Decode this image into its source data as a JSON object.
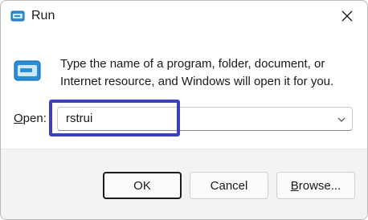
{
  "window": {
    "title": "Run"
  },
  "dialog": {
    "description": "Type the name of a program, folder, document, or Internet resource, and Windows will open it for you.",
    "open_label_accel": "O",
    "open_label_rest": "pen:",
    "open_value": "rstrui"
  },
  "buttons": {
    "ok": "OK",
    "cancel": "Cancel",
    "browse_accel": "B",
    "browse_rest": "rowse..."
  },
  "icons": {
    "title": "run-app-icon",
    "main": "run-app-icon",
    "close": "close-icon",
    "dropdown": "chevron-down-icon"
  },
  "colors": {
    "highlight": "#3d3fc1",
    "icon_blue": "#2a8fd6"
  }
}
